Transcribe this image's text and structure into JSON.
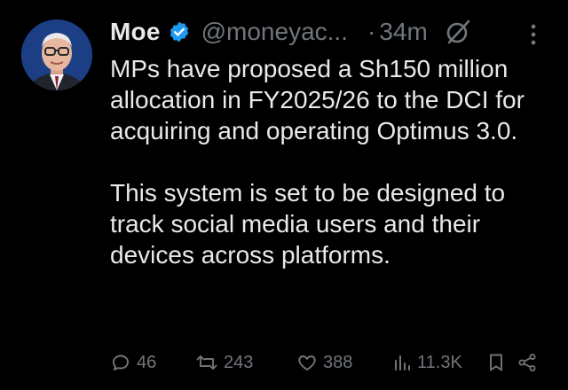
{
  "author": {
    "name": "Moe",
    "handle": "@moneyac...",
    "time_separator": "·",
    "time": "34m"
  },
  "tweet": {
    "paragraph1": "MPs have proposed a Sh150 million allocation in FY2025/26 to the DCI for acquiring and operating Optimus 3.0.",
    "paragraph2": "This system is set to be designed to track social media users and their devices across platforms."
  },
  "stats": {
    "replies": "46",
    "reposts": "243",
    "likes": "388",
    "views": "11.3K"
  },
  "colors": {
    "background": "#000000",
    "text": "#e7e9ea",
    "muted": "#71767b",
    "verified_blue": "#1d9bf0"
  },
  "icons": [
    "verified-badge-icon",
    "grok-icon",
    "more-icon",
    "reply-icon",
    "repost-icon",
    "like-icon",
    "views-icon",
    "bookmark-icon",
    "share-icon"
  ]
}
